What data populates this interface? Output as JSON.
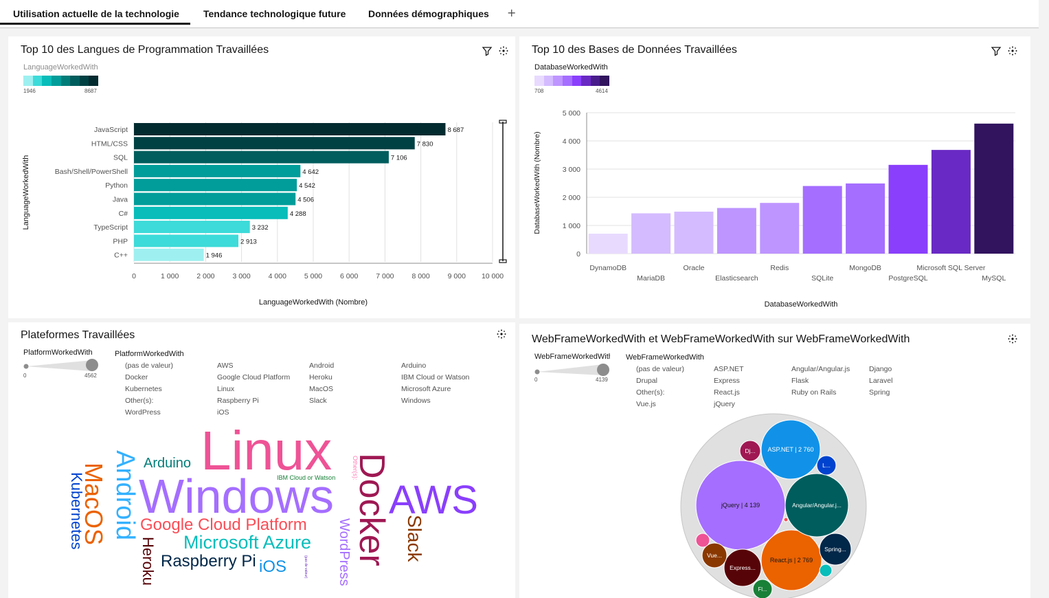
{
  "tabs": [
    {
      "label": "Utilisation actuelle de la technologie",
      "active": true
    },
    {
      "label": "Tendance technologique future"
    },
    {
      "label": "Données démographiques"
    }
  ],
  "tab_add_symbol": "+",
  "panels": {
    "languages": {
      "title": "Top 10 des Langues de Programmation Travaillées",
      "legend_title": "LanguageWorkedWith",
      "legend_min": "1946",
      "legend_max": "8687",
      "legend_colors": [
        "#9ef0f0",
        "#3ddbd9",
        "#08bdba",
        "#009d9a",
        "#007d79",
        "#005d5d",
        "#004144",
        "#022b30"
      ],
      "y_axis_label": "LanguageWorkedWith",
      "x_axis_label": "LanguageWorkedWith (Nombre)"
    },
    "databases": {
      "title": "Top 10 des Bases de Données Travaillées",
      "legend_title": "DatabaseWorkedWith",
      "legend_min": "708",
      "legend_max": "4614",
      "legend_colors": [
        "#e8daff",
        "#d4bbff",
        "#be95ff",
        "#a56eff",
        "#8a3ffc",
        "#6929c4",
        "#491d8b",
        "#31135e"
      ],
      "y_axis_label": "DatabaseWorkedWith (Nombre)",
      "x_axis_label": "DatabaseWorkedWith"
    },
    "platforms": {
      "title": "Plateformes Travaillées",
      "slider_title": "PlatformWorkedWith",
      "slider_min": "0",
      "slider_max": "4562",
      "list_title": "PlatformWorkedWith",
      "list_columns": [
        [
          "(pas de valeur)",
          "Docker",
          "Kubernetes",
          "Other(s):",
          "WordPress"
        ],
        [
          "AWS",
          "Google Cloud Platform",
          "Linux",
          "Raspberry Pi",
          "iOS"
        ],
        [
          "Android",
          "Heroku",
          "MacOS",
          "Slack"
        ],
        [
          "Arduino",
          "IBM Cloud or Watson",
          "Microsoft Azure",
          "Windows"
        ]
      ],
      "words": [
        {
          "text": "Linux",
          "color": "#ee5396"
        },
        {
          "text": "Windows",
          "color": "#a56eff"
        },
        {
          "text": "Docker",
          "color": "#9f1853"
        },
        {
          "text": "AWS",
          "color": "#8a3ffc"
        },
        {
          "text": "Android",
          "color": "#33b1ff"
        },
        {
          "text": "MacOS",
          "color": "#eb6200"
        },
        {
          "text": "Kubernetes",
          "color": "#0043ce"
        },
        {
          "text": "Arduino",
          "color": "#007d79"
        },
        {
          "text": "Google Cloud Platform",
          "color": "#fa4d56"
        },
        {
          "text": "Microsoft Azure",
          "color": "#08bdba"
        },
        {
          "text": "Raspberry Pi",
          "color": "#012749"
        },
        {
          "text": "iOS",
          "color": "#1192e8"
        },
        {
          "text": "Heroku",
          "color": "#570408"
        },
        {
          "text": "WordPress",
          "color": "#a56eff"
        },
        {
          "text": "Slack",
          "color": "#8a3800"
        },
        {
          "text": "IBM Cloud or Watson",
          "color": "#198038"
        },
        {
          "text": "Other(s):",
          "color": "#ff7eb6"
        },
        {
          "text": "(pas de valeur)",
          "color": "#6929c4"
        }
      ]
    },
    "webframes": {
      "title": "WebFrameWorkedWith et WebFrameWorkedWith sur WebFrameWorkedWith",
      "slider_title": "WebFrameWorkedWith",
      "slider_min": "0",
      "slider_max": "4139",
      "list_title": "WebFrameWorkedWith",
      "list_columns": [
        [
          "(pas de valeur)",
          "Drupal",
          "Other(s):",
          "Vue.js"
        ],
        [
          "ASP.NET",
          "Express",
          "React.js",
          "jQuery"
        ],
        [
          "Angular/Angular.js",
          "Flask",
          "Ruby on Rails"
        ],
        [
          "Django",
          "Laravel",
          "Spring"
        ]
      ],
      "bubbles": [
        {
          "label": "jQuery | 4 139",
          "color": "#a56eff",
          "text_color": "#161616"
        },
        {
          "label": "ASP.NET | 2 760",
          "color": "#1192e8",
          "text_color": "#ffffff"
        },
        {
          "label": "React.js | 2 769",
          "color": "#eb6200",
          "text_color": "#161616"
        },
        {
          "label": "Angular/Angular.j...",
          "color": "#005d5d",
          "text_color": "#ffffff"
        },
        {
          "label": "Express...",
          "color": "#570408",
          "text_color": "#ffffff"
        },
        {
          "label": "Spring...",
          "color": "#012749",
          "text_color": "#ffffff"
        },
        {
          "label": "Vue...",
          "color": "#8a3800",
          "text_color": "#ffffff"
        },
        {
          "label": "Dj...",
          "color": "#9f1853",
          "text_color": "#ffffff"
        },
        {
          "label": "L...",
          "color": "#0043ce",
          "text_color": "#ffffff"
        },
        {
          "label": "Fl...",
          "color": "#198038",
          "text_color": "#ffffff"
        },
        {
          "label": "",
          "color": "#ee5396",
          "text_color": "#ffffff"
        },
        {
          "label": "",
          "color": "#08bdba",
          "text_color": "#ffffff"
        },
        {
          "label": "",
          "color": "#fa4d56",
          "text_color": "#ffffff"
        }
      ]
    }
  },
  "chart_data": [
    {
      "type": "bar",
      "orientation": "horizontal",
      "title": "Top 10 des Langues de Programmation Travaillées",
      "categories": [
        "JavaScript",
        "HTML/CSS",
        "SQL",
        "Bash/Shell/PowerShell",
        "Python",
        "Java",
        "C#",
        "TypeScript",
        "PHP",
        "C++"
      ],
      "values": [
        8687,
        7830,
        7106,
        4642,
        4542,
        4506,
        4288,
        3232,
        2913,
        1946
      ],
      "value_labels": [
        "8 687",
        "7 830",
        "7 106",
        "4 642",
        "4 542",
        "4 506",
        "4 288",
        "3 232",
        "2 913",
        "1 946"
      ],
      "xticks": [
        "0",
        "1 000",
        "2 000",
        "3 000",
        "4 000",
        "5 000",
        "6 000",
        "7 000",
        "8 000",
        "9 000",
        "10 000"
      ],
      "xlim": [
        0,
        10000
      ],
      "xlabel": "LanguageWorkedWith (Nombre)",
      "ylabel": "LanguageWorkedWith",
      "grid": true
    },
    {
      "type": "bar",
      "orientation": "vertical",
      "title": "Top 10 des Bases de Données Travaillées",
      "categories": [
        "DynamoDB",
        "MariaDB",
        "Oracle",
        "Elasticsearch",
        "Redis",
        "SQLite",
        "MongoDB",
        "PostgreSQL",
        "Microsoft SQL Server",
        "MySQL"
      ],
      "values": [
        708,
        1430,
        1490,
        1620,
        1800,
        2400,
        2490,
        3150,
        3680,
        4614
      ],
      "yticks": [
        "0",
        "1 000",
        "2 000",
        "3 000",
        "4 000",
        "5 000"
      ],
      "ylim": [
        0,
        5000
      ],
      "xlabel": "DatabaseWorkedWith",
      "ylabel": "DatabaseWorkedWith (Nombre)",
      "grid": true
    }
  ]
}
